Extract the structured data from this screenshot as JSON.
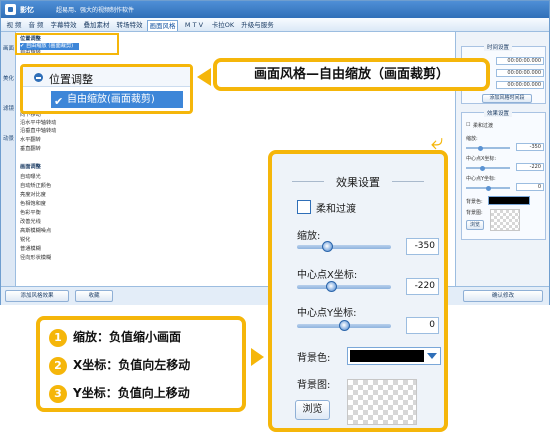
{
  "app": {
    "name": "影忆",
    "slogan": "超易用、强大的视频制作软件"
  },
  "menu": [
    {
      "label": "视  频",
      "active": false
    },
    {
      "label": "音  频",
      "active": false
    },
    {
      "label": "字幕特效",
      "active": false
    },
    {
      "label": "叠加素材",
      "active": false
    },
    {
      "label": "转场特效",
      "active": false
    },
    {
      "label": "画面风格",
      "active": true
    },
    {
      "label": "M T V",
      "active": false
    },
    {
      "label": "卡拉OK",
      "active": false
    },
    {
      "label": "升级与服务",
      "active": false
    }
  ],
  "sidebar": [
    {
      "label": "画面"
    },
    {
      "label": "美化"
    },
    {
      "label": "滤镜"
    },
    {
      "label": "动景"
    }
  ],
  "list": {
    "rows": [
      {
        "label": "位置调整",
        "kind": "cat"
      },
      {
        "label": "✔ 自由缩放 (画面裁剪)",
        "kind": "sel"
      },
      {
        "label": "自由旋转",
        "kind": "item"
      },
      {
        "label": "向下移动",
        "kind": "item"
      },
      {
        "label": "沿水平中轴转动",
        "kind": "item"
      },
      {
        "label": "沿垂直中轴转动",
        "kind": "item"
      },
      {
        "label": "水平翻转",
        "kind": "item"
      },
      {
        "label": "垂直翻转",
        "kind": "item"
      },
      {
        "label": "画面调整",
        "kind": "cat"
      },
      {
        "label": "自动曝光",
        "kind": "item"
      },
      {
        "label": "自动矫正颜色",
        "kind": "item"
      },
      {
        "label": "亮度对比度",
        "kind": "item"
      },
      {
        "label": "色相饱和度",
        "kind": "item"
      },
      {
        "label": "色彩平衡",
        "kind": "item"
      },
      {
        "label": "改善光线",
        "kind": "item"
      },
      {
        "label": "高斯模糊噪点",
        "kind": "item"
      },
      {
        "label": "锐化",
        "kind": "item"
      },
      {
        "label": "普通模糊",
        "kind": "item"
      },
      {
        "label": "径向形状模糊",
        "kind": "item"
      }
    ]
  },
  "bottom": {
    "add_btn": "添加风格效果",
    "fav_btn": "收藏",
    "confirm_btn": "确认修改"
  },
  "time_panel": {
    "legend": "时间设置",
    "values": [
      "00:00:00.000",
      "00:00:00.000",
      "00:00:00.000"
    ],
    "add_btn": "添加风格时间段"
  },
  "effect_panel_small": {
    "legend": "效果设置",
    "soft": "柔和过渡",
    "scale_label": "缩放:",
    "scale_value": "-350",
    "cx_label": "中心点X坐标:",
    "cx_value": "-220",
    "cy_label": "中心点Y坐标:",
    "cy_value": "0",
    "bgcolor_label": "背景色:",
    "bgimg_label": "背景图:",
    "browse": "浏览"
  },
  "callout_big": {
    "group": "位置调整",
    "item": "自由缩放(画面裁剪)"
  },
  "title_badge": "画面风格—自由缩放（画面裁剪）",
  "effect_panel_big": {
    "title": "效果设置",
    "soft": "柔和过渡",
    "scale_label": "缩放:",
    "scale_value": "-350",
    "scale_pos": 0.3,
    "cx_label": "中心点X坐标:",
    "cx_value": "-220",
    "cx_pos": 0.35,
    "cy_label": "中心点Y坐标:",
    "cy_value": "0",
    "cy_pos": 0.5,
    "bgcolor_label": "背景色:",
    "bgcolor": "#000000",
    "bgimg_label": "背景图:",
    "browse": "浏览"
  },
  "legend": [
    {
      "num": "1",
      "text": "缩放：负值缩小画面"
    },
    {
      "num": "2",
      "text": "X坐标：负值向左移动"
    },
    {
      "num": "3",
      "text": "Y坐标：负值向上移动"
    }
  ],
  "colors": {
    "accent": "#f5b60a",
    "primary": "#2f6fb8",
    "selection": "#3d86d8"
  }
}
